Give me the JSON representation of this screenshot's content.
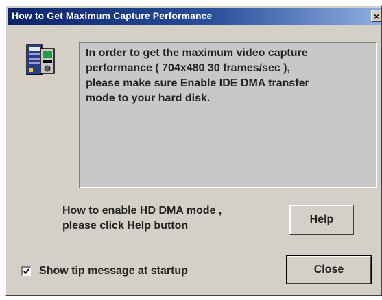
{
  "window": {
    "title": "How to Get Maximum Capture Performance",
    "close_glyph": "×"
  },
  "icon": "tip-computer-icon",
  "message": "In order to get the maximum video capture\nperformance ( 704x480 30 frames/sec ),\nplease make sure Enable IDE DMA transfer\nmode to your hard disk.",
  "help_prompt": "How to enable HD DMA mode ,\nplease click Help button",
  "buttons": {
    "help_label": "Help",
    "close_label": "Close"
  },
  "checkbox": {
    "label": "Show tip message at startup",
    "checked": true
  },
  "colors": {
    "title_bar_start": "#0a246a",
    "title_bar_end": "#8fb0e0",
    "face": "#d4d0c8"
  }
}
